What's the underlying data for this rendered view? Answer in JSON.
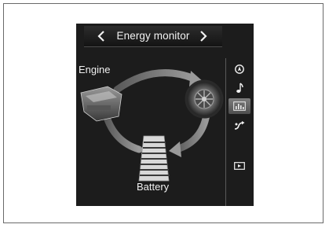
{
  "screen": {
    "title": "Energy monitor",
    "nav": {
      "prev_icon": "chevron-left-icon",
      "next_icon": "chevron-right-icon"
    }
  },
  "diagram": {
    "engine_label": "Engine",
    "battery_label": "Battery",
    "flows": [
      "engine-to-wheel",
      "wheel-to-battery",
      "battery-to-engine"
    ]
  },
  "sidebar": {
    "items": [
      {
        "icon": "navigation-icon",
        "active": false
      },
      {
        "icon": "music-note-icon",
        "active": false
      },
      {
        "icon": "energy-monitor-icon",
        "active": true
      },
      {
        "icon": "fuel-consumption-icon",
        "active": false
      },
      {
        "icon": "screen-toggle-icon",
        "active": false
      }
    ]
  },
  "colors": {
    "screen_bg": "#1c1c1c",
    "text": "#f0f0f0",
    "flow_arrow": "#8a8a8a",
    "active_tab": "#6a6a6a"
  }
}
